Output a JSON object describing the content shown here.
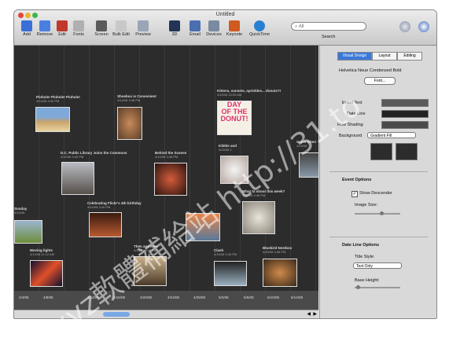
{
  "window": {
    "title": "Untitled"
  },
  "toolbar": [
    {
      "label": "Add",
      "color": "#3a6fd8"
    },
    {
      "label": "Remove",
      "color": "#4a7fe0"
    },
    {
      "label": "Edit",
      "color": "#c0392b"
    },
    {
      "label": "Fonts",
      "color": "#b0b0b0"
    },
    {
      "label": "Screen",
      "color": "#5b5b5b"
    },
    {
      "label": "Bulk Edit",
      "color": "#c8c8c8"
    },
    {
      "label": "Preview",
      "color": "#9aa6b8"
    },
    {
      "label": "3D",
      "color": "#223355"
    },
    {
      "label": "Email",
      "color": "#4a6fb0"
    },
    {
      "label": "Devices",
      "color": "#7a8aa0"
    },
    {
      "label": "Keynote",
      "color": "#d05a20"
    },
    {
      "label": "QuickTime",
      "color": "#2a7fd0"
    }
  ],
  "search": {
    "placeholder": "All",
    "label": "Search"
  },
  "events": [
    {
      "title": "Pinhole! Pinhole! Pinhole!",
      "date": "4/14/08 3:40 PM"
    },
    {
      "title": "Shoebox is Convenient",
      "date": "4/14/08 3:48 PM"
    },
    {
      "title": "Kittens, sunsets, sprinkles... donuts?!",
      "date": "4/15/08 10:05 AM"
    },
    {
      "title": "D.C. Public Library Joins the Commons",
      "date": "4/10/08 3:40 PM"
    },
    {
      "title": "Behind the Scenes",
      "date": "4/14/08 3:48 PM"
    },
    {
      "title": "Kibble and",
      "date": "4/15/08 1"
    },
    {
      "title": "Super Piten",
      "date": "4/15/08"
    },
    {
      "title": "Celebrating Flickr's 4th birthday",
      "date": "4/14/08 3:40 PM"
    },
    {
      "title": "What to shoot this week?",
      "date": "4/15/08 3:48 PM"
    },
    {
      "title": "Sunday",
      "date": "4/14/08"
    },
    {
      "title": "Moving lights",
      "date": "4/14/08 11:12 AM"
    },
    {
      "title": "Then and Now",
      "date": "4/14/08 3:48 PM"
    },
    {
      "title": "Clash",
      "date": "4/15/08 3:40 PM"
    },
    {
      "title": "Bluebird Nestbox",
      "date": "4/15/08 3:38 PM"
    }
  ],
  "axis_ticks": [
    "4/4/08",
    "4/8/08",
    "4/12/08",
    "4/16/08",
    "4/20/08",
    "4/24/08",
    "4/28/08",
    "5/2/08",
    "5/6/08",
    "5/10/08",
    "5/14/08",
    "5/18/08"
  ],
  "inspector": {
    "tabs": [
      "Visual Design",
      "Layout",
      "Editing"
    ],
    "font_name": "Helvetica Neue Condensed Bold",
    "font_button": "Font...",
    "event_text": "Event Text",
    "date_line": "Date Line",
    "row_shading": "Row Shading",
    "background": "Background",
    "background_value": "Gradient Fill",
    "event_options": "Event Options",
    "show_descender": "Show Descender",
    "image_size": "Image Size:",
    "date_line_options": "Date Line Options",
    "title_style": "Title Style:",
    "title_style_value": "Text Only",
    "base_height": "Base Height:"
  },
  "watermark": "xyz軟體補給站 http://31.to"
}
